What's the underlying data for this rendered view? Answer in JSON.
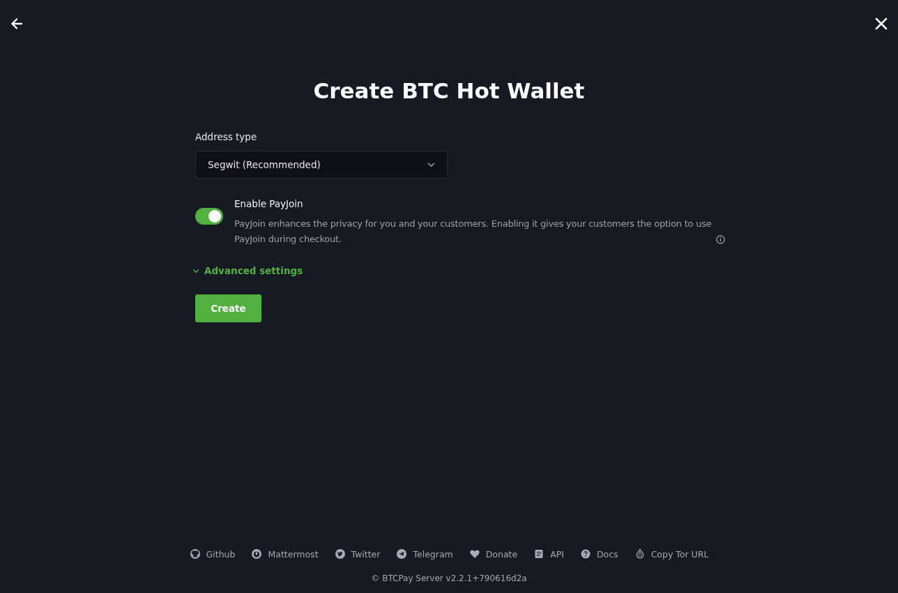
{
  "title": "Create BTC Hot Wallet",
  "address_type": {
    "label": "Address type",
    "value": "Segwit (Recommended)"
  },
  "payjoin": {
    "label": "Enable PayJoin",
    "on": true,
    "description": "PayJoin enhances the privacy for you and your customers. Enabling it gives your customers the option to use PayJoin during checkout."
  },
  "advanced_settings": {
    "label": "Advanced settings"
  },
  "buttons": [
    "Create"
  ],
  "footer_links": [
    {
      "label": "Github",
      "kind": "github"
    },
    {
      "label": "Mattermost",
      "kind": "mattermost"
    },
    {
      "label": "Twitter",
      "kind": "twitter"
    },
    {
      "label": "Telegram",
      "kind": "telegram"
    },
    {
      "label": "Donate",
      "kind": "heart"
    },
    {
      "label": "API",
      "kind": "document"
    },
    {
      "label": "Docs",
      "kind": "help"
    },
    {
      "label": "Copy Tor URL",
      "kind": "onion"
    }
  ],
  "copyright": "© BTCPay Server v2.2.1+790616d2a"
}
